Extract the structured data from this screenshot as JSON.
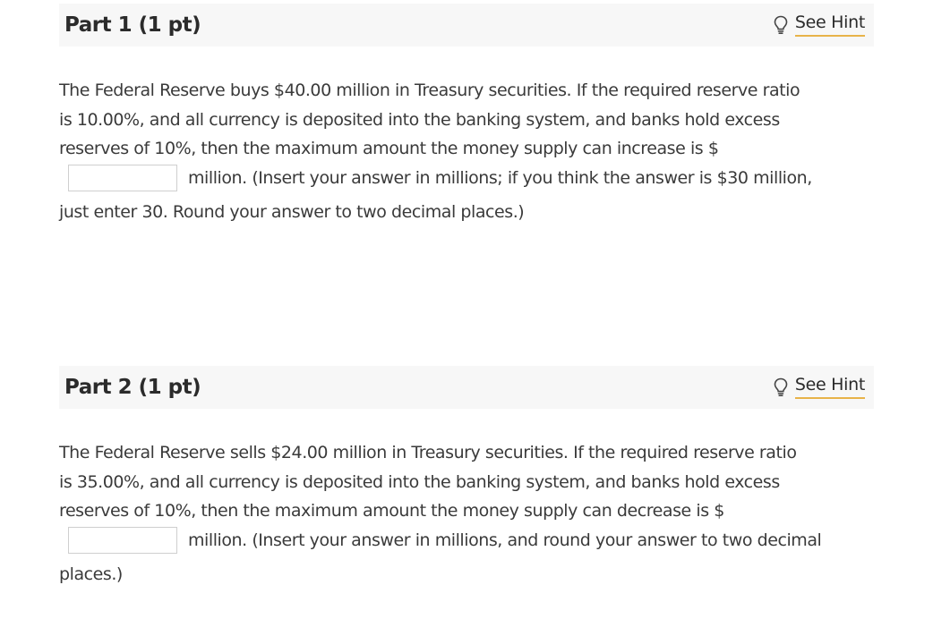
{
  "part1": {
    "title": "Part 1 (1 pt)",
    "hint_label": "See Hint",
    "line1": "The Federal Reserve buys $40.00 million in Treasury securities. If the required reserve ratio",
    "line2": "is 10.00%, and all currency is deposited into the banking system, and banks hold excess",
    "line3": "reserves of 10%, then the maximum amount the money supply can increase is $",
    "answer_value": "",
    "after_input": "million. (Insert your answer in millions; if you think the answer is $30 million,",
    "last_line": "just enter 30. Round your answer to two decimal places.)"
  },
  "part2": {
    "title": "Part 2 (1 pt)",
    "hint_label": "See Hint",
    "line1": "The Federal Reserve sells $24.00 million in Treasury securities. If the required reserve ratio",
    "line2": "is 35.00%, and all currency is deposited into the banking system, and banks hold excess",
    "line3": "reserves of 10%, then the maximum amount the money supply can decrease is $",
    "answer_value": "",
    "after_input": "million. (Insert your answer in millions, and round your answer to two decimal",
    "last_line": "places.)"
  },
  "icons": {
    "hint": "lightbulb-icon"
  }
}
